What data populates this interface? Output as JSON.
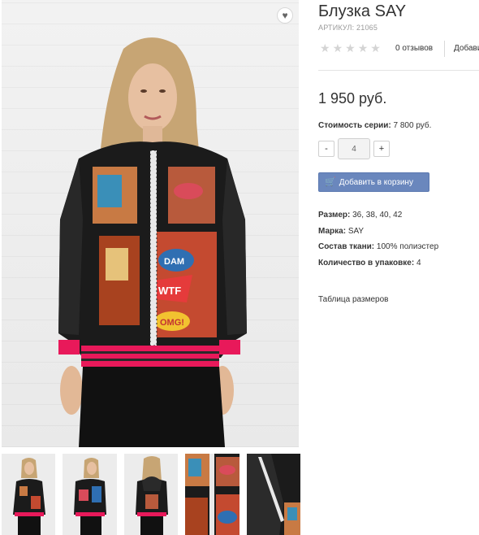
{
  "product": {
    "title": "Блузка SAY",
    "sku": "АРТИКУЛ: 21065",
    "rating": {
      "stars": 5,
      "filled": 0
    },
    "reviews_label": "0 отзывов",
    "add_review_label": "Добавить отзыв",
    "price": "1 950 руб.",
    "series_label": "Стоимость серии:",
    "series_value": "7 800 руб.",
    "quantity": {
      "minus": "-",
      "value": "4",
      "plus": "+"
    },
    "cart_button": {
      "icon": "cart-icon",
      "label": "Добавить в корзину"
    },
    "properties": [
      {
        "label": "Размер:",
        "value": "36, 38, 40, 42"
      },
      {
        "label": "Марка:",
        "value": "SAY"
      },
      {
        "label": "Состав ткани:",
        "value": "100% полиэстер"
      },
      {
        "label": "Количество в упаковке:",
        "value": "4"
      }
    ],
    "size_table_link": "Таблица размеров",
    "wishlist_icon": "heart-icon"
  },
  "colors": {
    "accent": "#6a87bd",
    "stripe": "#e8195a",
    "blouse": "#1b1b1b"
  },
  "gallery": {
    "thumbnails": [
      "front",
      "side",
      "back",
      "detail-print",
      "detail-hood"
    ]
  }
}
